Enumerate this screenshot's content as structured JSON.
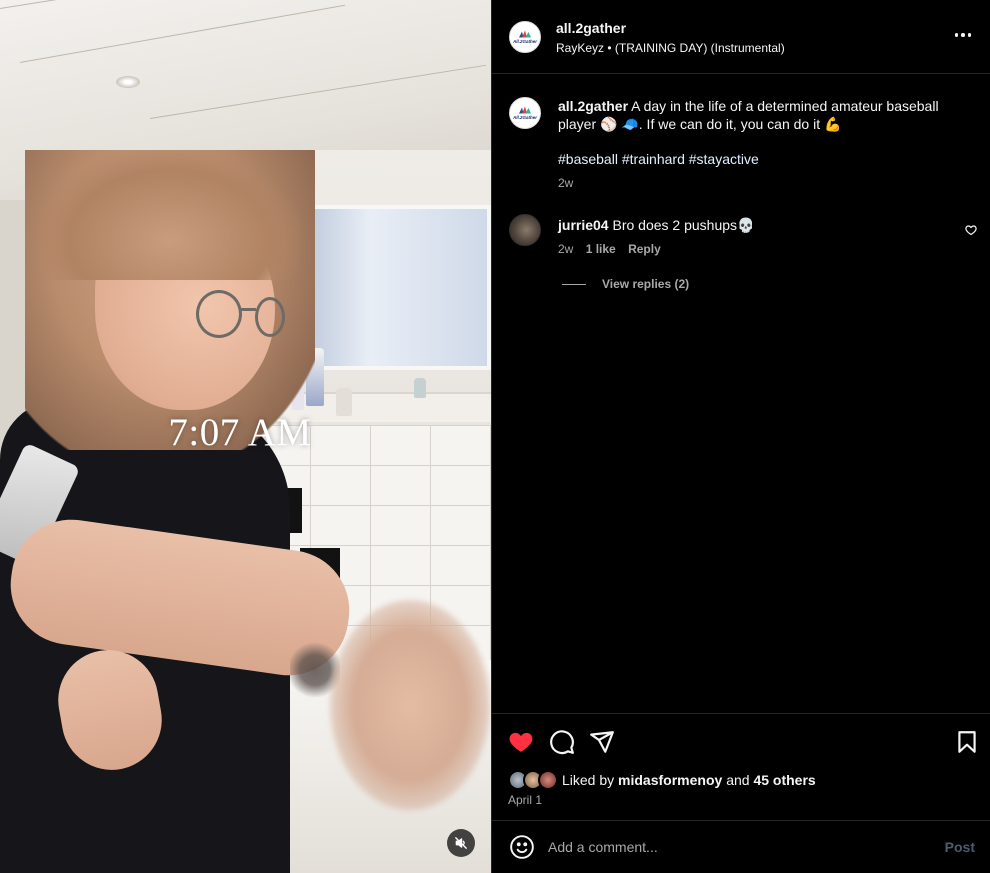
{
  "media": {
    "overlay_text": "7:07 AM",
    "mute_icon": "speaker-muted-icon"
  },
  "header": {
    "username": "all.2gather",
    "audio": "RayKeyz • (TRAINING DAY) (Instrumental)",
    "more_icon": "more-options-icon",
    "avatar_logo_text": "All.2Gather"
  },
  "caption": {
    "username": "all.2gather",
    "text": "A day in the life of a determined amateur baseball player ⚾ 🧢. If we can do it, you can do it 💪",
    "hashtags": "#baseball #trainhard #stayactive",
    "time": "2w"
  },
  "comments": [
    {
      "username": "jurrie04",
      "text": "Bro does 2 pushups💀",
      "time": "2w",
      "likes": "1 like",
      "reply_label": "Reply",
      "view_replies": "View replies (2)"
    }
  ],
  "actions": {
    "liked_by_prefix": "Liked by",
    "liked_by_user": "midasformenoy",
    "liked_by_and": "and",
    "liked_by_others": "45 others",
    "date": "April 1",
    "like_color": "#ff3040"
  },
  "comment_box": {
    "placeholder": "Add a comment...",
    "post_label": "Post"
  }
}
